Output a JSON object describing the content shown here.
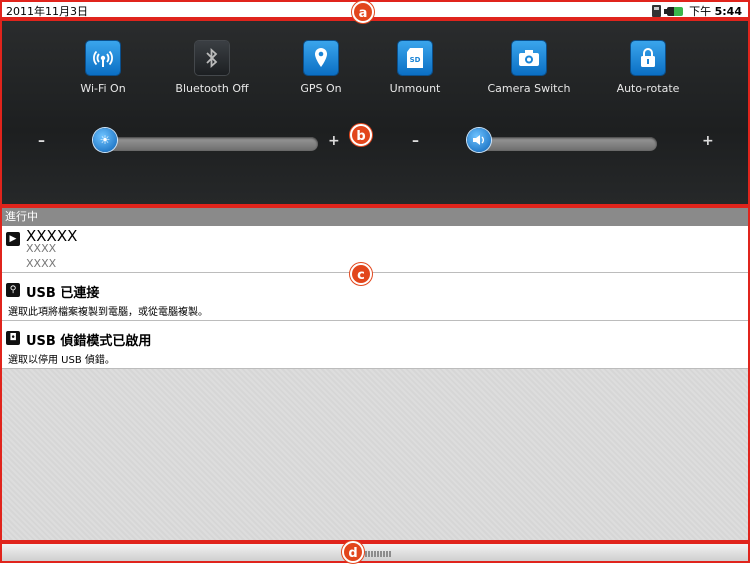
{
  "status_bar": {
    "date": "2011年11月3日",
    "time_period": "下午",
    "time": "5:44",
    "icons": [
      "sim-card-icon",
      "battery-icon"
    ]
  },
  "quick_settings": {
    "toggles": [
      {
        "label": "Wi-Fi On",
        "icon": "wifi-icon",
        "state": "on"
      },
      {
        "label": "Bluetooth Off",
        "icon": "bluetooth-icon",
        "state": "off"
      },
      {
        "label": "GPS On",
        "icon": "location-pin-icon",
        "state": "on"
      },
      {
        "label": "Unmount",
        "icon": "sd-card-icon",
        "state": "on"
      },
      {
        "label": "Camera Switch",
        "icon": "camera-icon",
        "state": "on"
      },
      {
        "label": "Auto-rotate",
        "icon": "lock-icon",
        "state": "on"
      }
    ],
    "brightness": {
      "minus": "–",
      "plus": "+",
      "level": 0.0,
      "icon": "brightness-icon"
    },
    "volume": {
      "minus": "–",
      "plus": "+",
      "level": 0.0,
      "icon": "speaker-icon"
    }
  },
  "notifications": {
    "ongoing_header": "進行中",
    "media": {
      "title": "XXXXX",
      "line1": "XXXX",
      "line2": "XXXX",
      "icon": "play-icon"
    },
    "items": [
      {
        "title": "USB 已連接",
        "desc": "選取此項將檔案複製到電腦，或從電腦複製。",
        "icon": "usb-icon"
      },
      {
        "title": "USB 偵錯模式已啟用",
        "desc": "選取以停用 USB 偵錯。",
        "icon": "debug-icon"
      }
    ]
  },
  "markers": {
    "a": "a",
    "b": "b",
    "c": "c",
    "d": "d"
  },
  "colors": {
    "annotation": "#e0241c",
    "toggle_on": "#1a84d6",
    "panel_bg": "#222425"
  }
}
